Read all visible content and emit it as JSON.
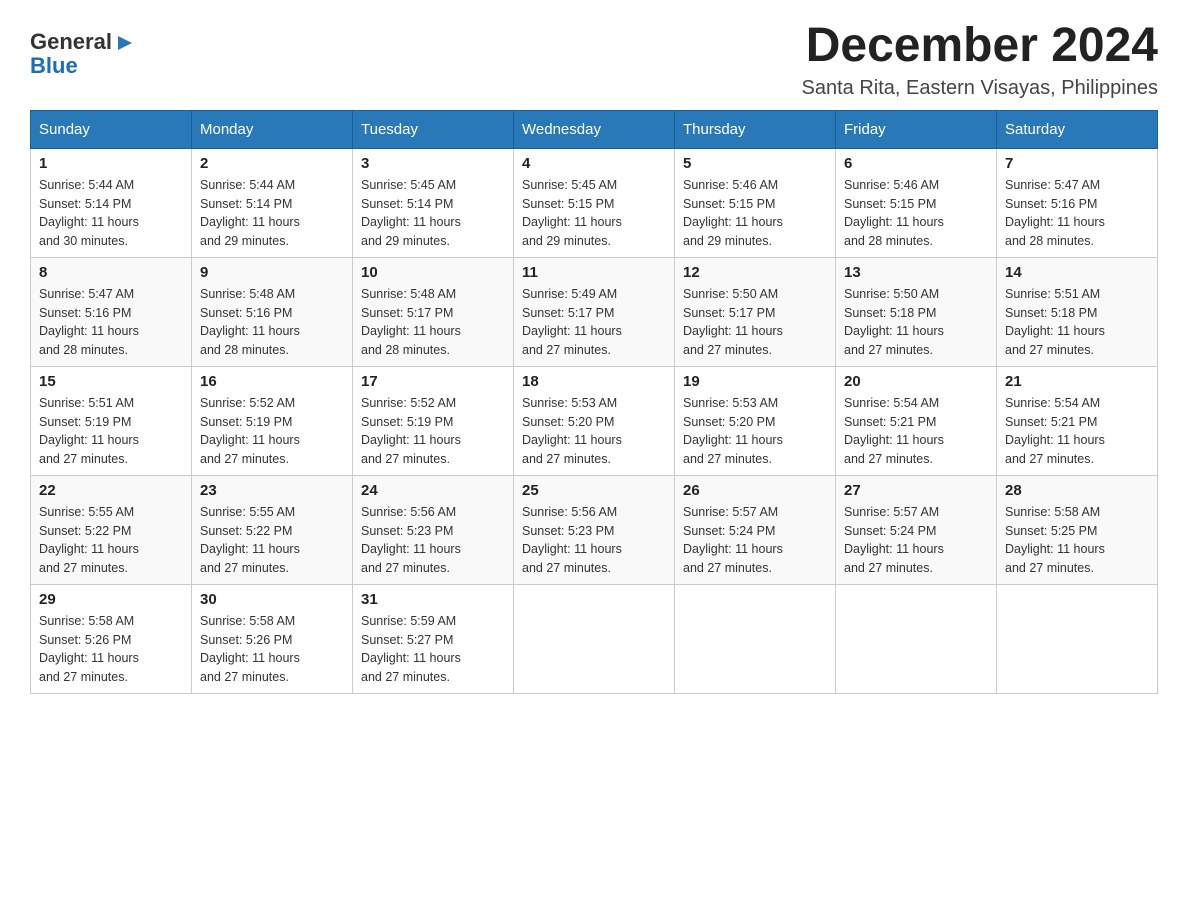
{
  "header": {
    "logo_general": "General",
    "logo_blue": "Blue",
    "title": "December 2024",
    "subtitle": "Santa Rita, Eastern Visayas, Philippines"
  },
  "days_of_week": [
    "Sunday",
    "Monday",
    "Tuesday",
    "Wednesday",
    "Thursday",
    "Friday",
    "Saturday"
  ],
  "weeks": [
    [
      {
        "day": "1",
        "sunrise": "5:44 AM",
        "sunset": "5:14 PM",
        "daylight": "11 hours and 30 minutes."
      },
      {
        "day": "2",
        "sunrise": "5:44 AM",
        "sunset": "5:14 PM",
        "daylight": "11 hours and 29 minutes."
      },
      {
        "day": "3",
        "sunrise": "5:45 AM",
        "sunset": "5:14 PM",
        "daylight": "11 hours and 29 minutes."
      },
      {
        "day": "4",
        "sunrise": "5:45 AM",
        "sunset": "5:15 PM",
        "daylight": "11 hours and 29 minutes."
      },
      {
        "day": "5",
        "sunrise": "5:46 AM",
        "sunset": "5:15 PM",
        "daylight": "11 hours and 29 minutes."
      },
      {
        "day": "6",
        "sunrise": "5:46 AM",
        "sunset": "5:15 PM",
        "daylight": "11 hours and 28 minutes."
      },
      {
        "day": "7",
        "sunrise": "5:47 AM",
        "sunset": "5:16 PM",
        "daylight": "11 hours and 28 minutes."
      }
    ],
    [
      {
        "day": "8",
        "sunrise": "5:47 AM",
        "sunset": "5:16 PM",
        "daylight": "11 hours and 28 minutes."
      },
      {
        "day": "9",
        "sunrise": "5:48 AM",
        "sunset": "5:16 PM",
        "daylight": "11 hours and 28 minutes."
      },
      {
        "day": "10",
        "sunrise": "5:48 AM",
        "sunset": "5:17 PM",
        "daylight": "11 hours and 28 minutes."
      },
      {
        "day": "11",
        "sunrise": "5:49 AM",
        "sunset": "5:17 PM",
        "daylight": "11 hours and 27 minutes."
      },
      {
        "day": "12",
        "sunrise": "5:50 AM",
        "sunset": "5:17 PM",
        "daylight": "11 hours and 27 minutes."
      },
      {
        "day": "13",
        "sunrise": "5:50 AM",
        "sunset": "5:18 PM",
        "daylight": "11 hours and 27 minutes."
      },
      {
        "day": "14",
        "sunrise": "5:51 AM",
        "sunset": "5:18 PM",
        "daylight": "11 hours and 27 minutes."
      }
    ],
    [
      {
        "day": "15",
        "sunrise": "5:51 AM",
        "sunset": "5:19 PM",
        "daylight": "11 hours and 27 minutes."
      },
      {
        "day": "16",
        "sunrise": "5:52 AM",
        "sunset": "5:19 PM",
        "daylight": "11 hours and 27 minutes."
      },
      {
        "day": "17",
        "sunrise": "5:52 AM",
        "sunset": "5:19 PM",
        "daylight": "11 hours and 27 minutes."
      },
      {
        "day": "18",
        "sunrise": "5:53 AM",
        "sunset": "5:20 PM",
        "daylight": "11 hours and 27 minutes."
      },
      {
        "day": "19",
        "sunrise": "5:53 AM",
        "sunset": "5:20 PM",
        "daylight": "11 hours and 27 minutes."
      },
      {
        "day": "20",
        "sunrise": "5:54 AM",
        "sunset": "5:21 PM",
        "daylight": "11 hours and 27 minutes."
      },
      {
        "day": "21",
        "sunrise": "5:54 AM",
        "sunset": "5:21 PM",
        "daylight": "11 hours and 27 minutes."
      }
    ],
    [
      {
        "day": "22",
        "sunrise": "5:55 AM",
        "sunset": "5:22 PM",
        "daylight": "11 hours and 27 minutes."
      },
      {
        "day": "23",
        "sunrise": "5:55 AM",
        "sunset": "5:22 PM",
        "daylight": "11 hours and 27 minutes."
      },
      {
        "day": "24",
        "sunrise": "5:56 AM",
        "sunset": "5:23 PM",
        "daylight": "11 hours and 27 minutes."
      },
      {
        "day": "25",
        "sunrise": "5:56 AM",
        "sunset": "5:23 PM",
        "daylight": "11 hours and 27 minutes."
      },
      {
        "day": "26",
        "sunrise": "5:57 AM",
        "sunset": "5:24 PM",
        "daylight": "11 hours and 27 minutes."
      },
      {
        "day": "27",
        "sunrise": "5:57 AM",
        "sunset": "5:24 PM",
        "daylight": "11 hours and 27 minutes."
      },
      {
        "day": "28",
        "sunrise": "5:58 AM",
        "sunset": "5:25 PM",
        "daylight": "11 hours and 27 minutes."
      }
    ],
    [
      {
        "day": "29",
        "sunrise": "5:58 AM",
        "sunset": "5:26 PM",
        "daylight": "11 hours and 27 minutes."
      },
      {
        "day": "30",
        "sunrise": "5:58 AM",
        "sunset": "5:26 PM",
        "daylight": "11 hours and 27 minutes."
      },
      {
        "day": "31",
        "sunrise": "5:59 AM",
        "sunset": "5:27 PM",
        "daylight": "11 hours and 27 minutes."
      },
      null,
      null,
      null,
      null
    ]
  ],
  "labels": {
    "sunrise": "Sunrise:",
    "sunset": "Sunset:",
    "daylight": "Daylight:"
  }
}
